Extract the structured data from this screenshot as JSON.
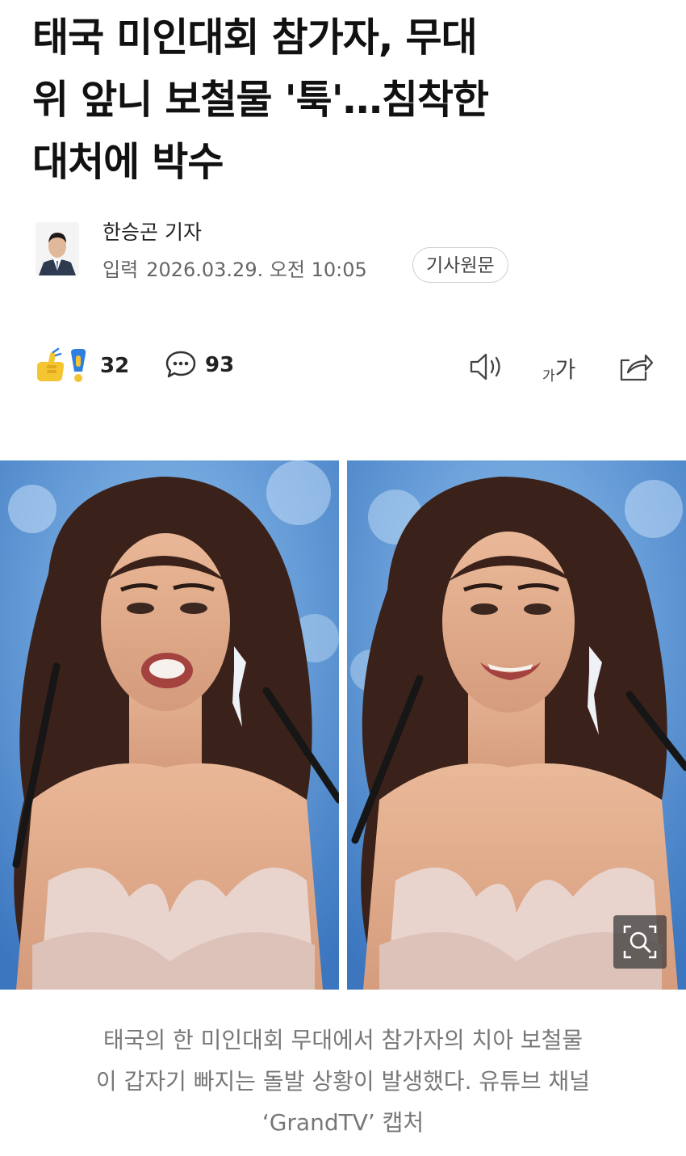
{
  "article": {
    "headline_lines": [
      "태국 미인대회 참가자, 무대",
      "위 앞니 보철물 '툭'…침착한",
      "대처에 박수"
    ],
    "author": "한승곤 기자",
    "date_label": "입력",
    "date_value": "2026.03.29. 오전 10:05",
    "original_button": "기사원문"
  },
  "toolbar": {
    "reaction_count": "32",
    "comment_count": "93",
    "font_size_label_small": "가",
    "font_size_label_large": "가"
  },
  "photo": {
    "caption_lines": [
      "태국의 한 미인대회 무대에서 참가자의 치아 보철물",
      "이 갑자기 빠지는 돌발 상황이 발생했다. 유튜브 채널",
      "‘GrandTV’ 캡처"
    ]
  },
  "colors": {
    "accent_yellow": "#f5c531",
    "accent_blue": "#2f7fe0",
    "stage_blue": "#5f98d6"
  },
  "icons": [
    "reaction-icon",
    "comment-icon",
    "speaker-icon",
    "font-size-icon",
    "share-icon",
    "zoom-icon"
  ]
}
